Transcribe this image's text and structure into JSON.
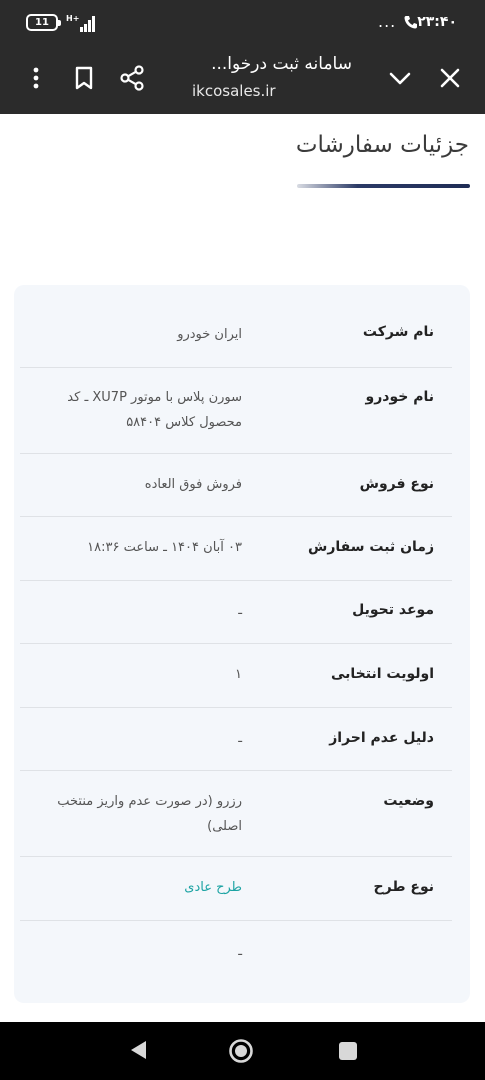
{
  "status_bar": {
    "battery": "11",
    "signal_text": "H+",
    "dots": "...",
    "time": "۲۳:۴۰"
  },
  "toolbar": {
    "title": "سامانه ثبت درخوا...",
    "url": "ikcosales.ir"
  },
  "page": {
    "title": "جزئیات سفارشات"
  },
  "details": [
    {
      "label": "نام شرکت",
      "value": "ایران خودرو"
    },
    {
      "label": "نام خودرو",
      "value": "سورن پلاس با موتور XU7P ـ کد محصول کلاس ۵۸۴۰۴"
    },
    {
      "label": "نوع فروش",
      "value": "فروش فوق العاده"
    },
    {
      "label": "زمان ثبت سفارش",
      "value": "۰۳ آبان ۱۴۰۴ ـ ساعت ۱۸:۳۶"
    },
    {
      "label": "موعد تحویل",
      "value": "ـ"
    },
    {
      "label": "اولویت انتخابی",
      "value": "۱"
    },
    {
      "label": "دلیل عدم احراز",
      "value": "ـ"
    },
    {
      "label": "وضعیت",
      "value": "رزرو (در صورت عدم واریز منتخب اصلی)"
    },
    {
      "label": "نوع طرح",
      "value": "طرح عادی"
    },
    {
      "label": "",
      "value": "ـ"
    }
  ],
  "colors": {
    "bar_bg": "#2b2b2b",
    "card_bg": "#f4f7fb",
    "link": "#1ba3a3",
    "accent": "#1f2c55"
  }
}
